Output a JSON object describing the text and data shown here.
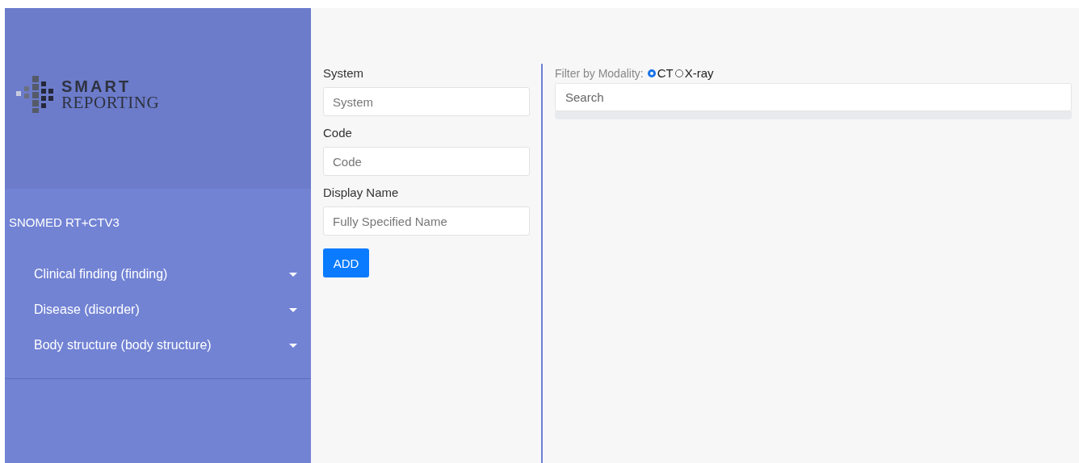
{
  "logo": {
    "line_1": "SMART",
    "line_2": "REPORTING"
  },
  "sidebar": {
    "title": "SNOMED RT+CTV3",
    "items": [
      {
        "label": "Clinical finding (finding)",
        "expanded": false
      },
      {
        "label": "Disease (disorder)",
        "expanded": false
      },
      {
        "label": "Body structure (body structure)",
        "expanded": false
      }
    ]
  },
  "form": {
    "fields": [
      {
        "label": "System",
        "placeholder": "System"
      },
      {
        "label": "Code",
        "placeholder": "Code"
      },
      {
        "label": "Display Name",
        "placeholder": "Fully Specified Name"
      }
    ],
    "button": "ADD"
  },
  "filter": {
    "label": "Filter by Modality:",
    "options": [
      {
        "label": "CT",
        "selected": true
      },
      {
        "label": "X-ray",
        "selected": false
      }
    ]
  },
  "search": {
    "placeholder": "Search"
  }
}
